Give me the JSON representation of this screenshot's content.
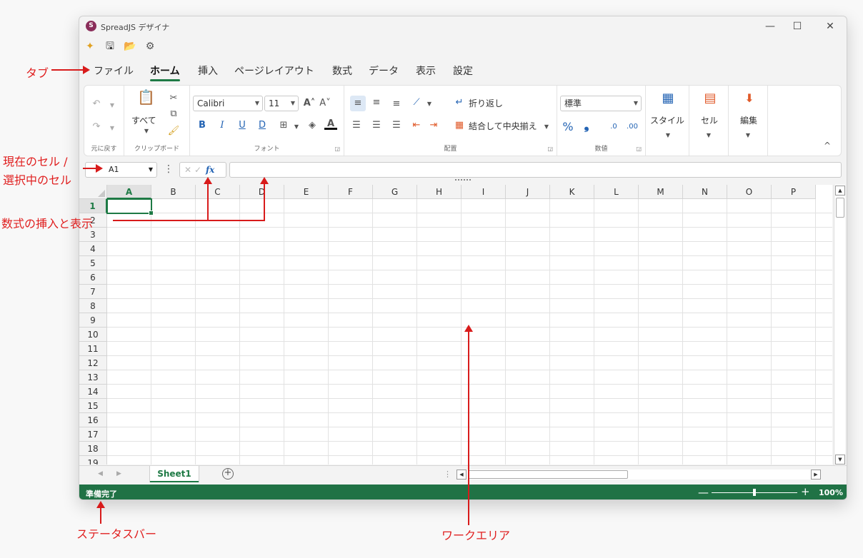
{
  "window": {
    "title": "SpreadJS デザイナ",
    "logo_letter": "S",
    "controls": {
      "minimize": "—",
      "maximize": "☐",
      "close": "✕"
    }
  },
  "quick_access": [
    {
      "name": "new-file-icon",
      "glyph": "✦"
    },
    {
      "name": "save-icon",
      "glyph": "🖫"
    },
    {
      "name": "open-folder-icon",
      "glyph": "📂"
    },
    {
      "name": "settings-icon",
      "glyph": "⚙"
    }
  ],
  "tabs": [
    "ファイル",
    "ホーム",
    "挿入",
    "ページレイアウト",
    "数式",
    "データ",
    "表示",
    "設定"
  ],
  "active_tab": "ホーム",
  "ribbon": {
    "undo_group": {
      "label": "元に戻す"
    },
    "clipboard": {
      "label": "クリップボード",
      "paste_label": "すべて"
    },
    "font": {
      "label": "フォント",
      "family": "Calibri",
      "size": "11"
    },
    "alignment": {
      "label": "配置",
      "wrap_text": "折り返し",
      "merge_center": "結合して中央揃え"
    },
    "number": {
      "label": "数値",
      "format": "標準"
    },
    "styles": {
      "label": "スタイル"
    },
    "cells": {
      "label": "セル"
    },
    "editing": {
      "label": "編集"
    },
    "collapse_glyph": "^"
  },
  "formula": {
    "name_box": "A1",
    "fx_label": "fx",
    "value": ""
  },
  "grid": {
    "columns": [
      "A",
      "B",
      "C",
      "D",
      "E",
      "F",
      "G",
      "H",
      "I",
      "J",
      "K",
      "L",
      "M",
      "N",
      "O",
      "P"
    ],
    "rows": [
      "1",
      "2",
      "3",
      "4",
      "5",
      "6",
      "7",
      "8",
      "9",
      "10",
      "11",
      "12",
      "13",
      "14",
      "15",
      "16",
      "17",
      "18",
      "19"
    ],
    "selected_cell": "A1"
  },
  "sheets": {
    "tabs": [
      "Sheet1"
    ],
    "active": "Sheet1",
    "add_glyph": "+"
  },
  "status": {
    "text": "準備完了",
    "zoom": "100%",
    "zoom_minus": "—",
    "zoom_plus": "+",
    "zoom_fraction": 0.5
  },
  "annotations": {
    "tabs": "タブ",
    "current_cell": "現在のセル /",
    "current_cell_2": "選択中のセル",
    "formula": "数式の挿入と表示",
    "status_bar": "ステータスバー",
    "work_area": "ワークエリア"
  },
  "colors": {
    "accent": "#1e7a45",
    "statusbar": "#207245",
    "annotation": "#e02020"
  }
}
